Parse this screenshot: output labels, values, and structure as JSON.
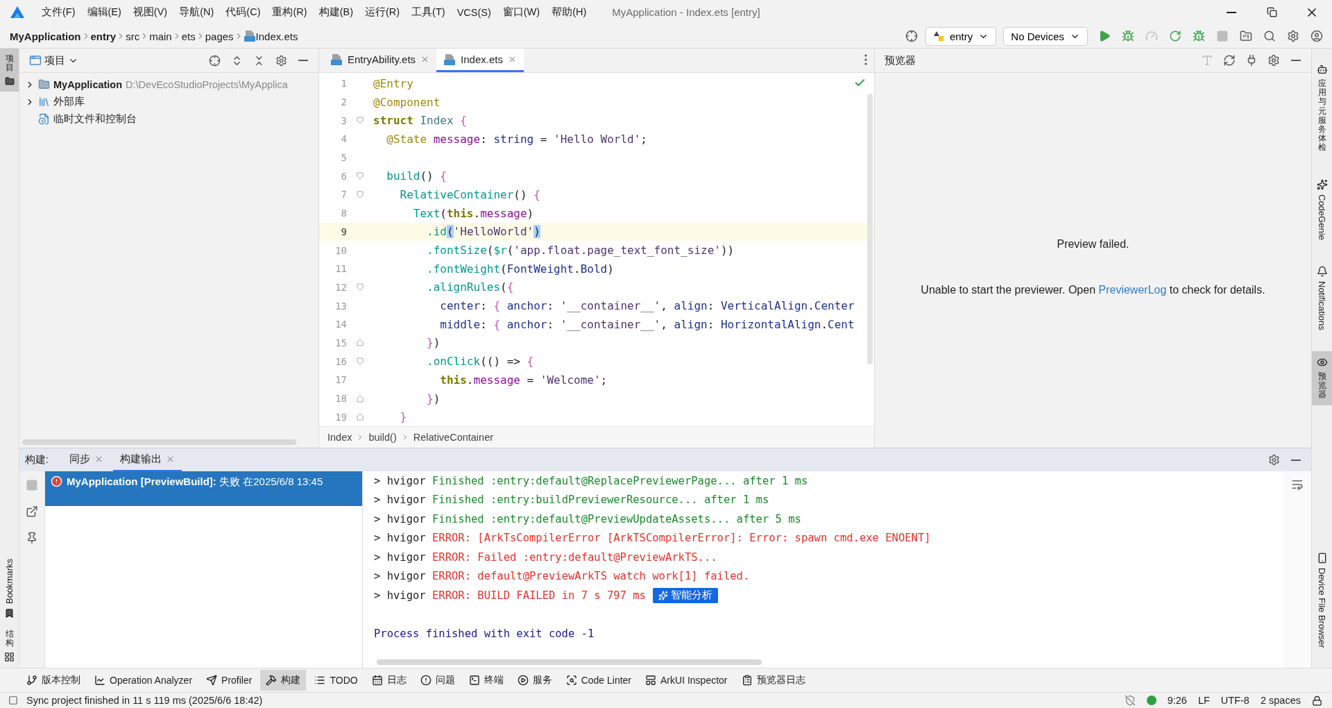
{
  "title_bar": {
    "menus": [
      "文件(F)",
      "编辑(E)",
      "视图(V)",
      "导航(N)",
      "代码(C)",
      "重构(R)",
      "构建(B)",
      "运行(R)",
      "工具(T)",
      "VCS(S)",
      "窗口(W)",
      "帮助(H)"
    ],
    "title": "MyApplication - Index.ets [entry]"
  },
  "nav_bar": {
    "path": [
      {
        "label": "MyApplication",
        "bold": true
      },
      {
        "label": "entry",
        "bold": true
      },
      {
        "label": "src",
        "bold": false
      },
      {
        "label": "main",
        "bold": false
      },
      {
        "label": "ets",
        "bold": false
      },
      {
        "label": "pages",
        "bold": false
      },
      {
        "label": "Index.ets",
        "bold": false,
        "kind": "file"
      }
    ],
    "module": "entry",
    "device": "No Devices",
    "actions": [
      {
        "kind": "run",
        "disabled": false
      },
      {
        "kind": "debug",
        "disabled": false
      },
      {
        "kind": "profile",
        "disabled": true
      },
      {
        "kind": "reload",
        "disabled": false
      },
      {
        "kind": "attach",
        "disabled": false
      },
      {
        "kind": "stop",
        "disabled": true
      },
      {
        "kind": "structure",
        "disabled": false
      },
      {
        "kind": "search",
        "disabled": false
      },
      {
        "kind": "settings",
        "disabled": false
      },
      {
        "kind": "account",
        "disabled": false
      }
    ]
  },
  "left_stripe": {
    "top": [
      {
        "label": "项目",
        "selected": true
      }
    ],
    "bottom": [
      {
        "label": "Bookmarks",
        "kind": "bookmark",
        "selected": false
      },
      {
        "label": "结构",
        "kind": "structure",
        "selected": false
      }
    ]
  },
  "right_stripe": [
    {
      "label": "应用与元服务体检",
      "kind": "robot",
      "selected": false
    },
    {
      "label": "CodeGenie",
      "kind": "genie",
      "selected": false
    },
    {
      "label": "Notifications",
      "kind": "bell",
      "selected": false
    },
    {
      "label": "预览器",
      "kind": "eye",
      "selected": true
    },
    {
      "label": "Device File Browser",
      "kind": "device",
      "selected": false
    }
  ],
  "project": {
    "title": "项目",
    "tree": [
      {
        "label": "MyApplication",
        "detail": "D:\\DevEcoStudioProjects\\MyApplica",
        "kind": "module",
        "expanded": false
      },
      {
        "label": "外部库",
        "kind": "library",
        "expanded": false
      },
      {
        "label": "临时文件和控制台",
        "kind": "scratch"
      }
    ]
  },
  "editor": {
    "tabs": [
      {
        "label": "EntryAbility.ets",
        "selected": false
      },
      {
        "label": "Index.ets",
        "selected": true
      }
    ],
    "lines": [
      {
        "number": "1",
        "current": false,
        "kind": "plain",
        "tokens": [
          {
            "kind": "annotation",
            "text": "@Entry"
          }
        ]
      },
      {
        "number": "2",
        "current": false,
        "kind": "plain",
        "tokens": [
          {
            "kind": "annotation",
            "text": "@Component"
          }
        ]
      },
      {
        "number": "3",
        "current": false,
        "kind": "fold_start",
        "tokens": [
          {
            "kind": "keyword",
            "text": "struct"
          },
          {
            "kind": "class",
            "text": " Index"
          },
          {
            "kind": "brace",
            "text": " {"
          }
        ]
      },
      {
        "number": "4",
        "current": false,
        "kind": "plain",
        "tokens": [
          {
            "kind": "annotation",
            "text": "  @State"
          },
          {
            "kind": "field",
            "text": " message"
          },
          {
            "kind": "plain",
            "text": ": "
          },
          {
            "kind": "type",
            "text": "string"
          },
          {
            "kind": "plain",
            "text": " = "
          },
          {
            "kind": "string",
            "text": "'Hello World'"
          },
          {
            "kind": "plain",
            "text": ";"
          }
        ]
      },
      {
        "number": "5",
        "current": false,
        "kind": "plain"
      },
      {
        "number": "6",
        "current": false,
        "kind": "fold_start",
        "tokens": [
          {
            "kind": "call",
            "text": "  build"
          },
          {
            "kind": "plain",
            "text": "() "
          },
          {
            "kind": "brace",
            "text": "{"
          }
        ]
      },
      {
        "number": "7",
        "current": false,
        "kind": "fold_start",
        "tokens": [
          {
            "kind": "call",
            "text": "    RelativeContainer"
          },
          {
            "kind": "plain",
            "text": "() "
          },
          {
            "kind": "brace",
            "text": "{"
          }
        ]
      },
      {
        "number": "8",
        "current": false,
        "kind": "plain",
        "tokens": [
          {
            "kind": "call",
            "text": "      Text"
          },
          {
            "kind": "plain",
            "text": "("
          },
          {
            "kind": "keyword",
            "text": "this"
          },
          {
            "kind": "plain",
            "text": "."
          },
          {
            "kind": "field",
            "text": "message"
          },
          {
            "kind": "plain",
            "text": ")"
          }
        ]
      },
      {
        "number": "9",
        "current": true,
        "kind": "plain",
        "tokens": [
          {
            "kind": "call",
            "text": "        .id"
          },
          {
            "kind": "match",
            "text": "("
          },
          {
            "kind": "string",
            "text": "'HelloWorld'"
          },
          {
            "kind": "match",
            "text": ")"
          }
        ]
      },
      {
        "number": "10",
        "current": false,
        "kind": "plain",
        "tokens": [
          {
            "kind": "call",
            "text": "        .fontSize"
          },
          {
            "kind": "plain",
            "text": "("
          },
          {
            "kind": "call",
            "text": "$r"
          },
          {
            "kind": "plain",
            "text": "("
          },
          {
            "kind": "string",
            "text": "'app.float.page_text_font_size'"
          },
          {
            "kind": "plain",
            "text": "))"
          }
        ]
      },
      {
        "number": "11",
        "current": false,
        "kind": "plain",
        "tokens": [
          {
            "kind": "call",
            "text": "        .fontWeight"
          },
          {
            "kind": "plain",
            "text": "("
          },
          {
            "kind": "type",
            "text": "FontWeight"
          },
          {
            "kind": "plain",
            "text": "."
          },
          {
            "kind": "prop",
            "text": "Bold"
          },
          {
            "kind": "plain",
            "text": ")"
          }
        ]
      },
      {
        "number": "12",
        "current": false,
        "kind": "fold_start",
        "tokens": [
          {
            "kind": "call",
            "text": "        .alignRules"
          },
          {
            "kind": "plain",
            "text": "("
          },
          {
            "kind": "brace",
            "text": "{"
          }
        ]
      },
      {
        "number": "13",
        "current": false,
        "kind": "plain",
        "tokens": [
          {
            "kind": "prop",
            "text": "          center"
          },
          {
            "kind": "plain",
            "text": ": "
          },
          {
            "kind": "brace",
            "text": "{"
          },
          {
            "kind": "prop",
            "text": " anchor"
          },
          {
            "kind": "plain",
            "text": ": "
          },
          {
            "kind": "string",
            "text": "'__container__'"
          },
          {
            "kind": "plain",
            "text": ", "
          },
          {
            "kind": "prop",
            "text": "align"
          },
          {
            "kind": "plain",
            "text": ": "
          },
          {
            "kind": "type",
            "text": "VerticalAlign"
          },
          {
            "kind": "plain",
            "text": "."
          },
          {
            "kind": "prop",
            "text": "Center"
          }
        ]
      },
      {
        "number": "14",
        "current": false,
        "kind": "plain",
        "tokens": [
          {
            "kind": "prop",
            "text": "          middle"
          },
          {
            "kind": "plain",
            "text": ": "
          },
          {
            "kind": "brace",
            "text": "{"
          },
          {
            "kind": "prop",
            "text": " anchor"
          },
          {
            "kind": "plain",
            "text": ": "
          },
          {
            "kind": "string",
            "text": "'__container__'"
          },
          {
            "kind": "plain",
            "text": ", "
          },
          {
            "kind": "prop",
            "text": "align"
          },
          {
            "kind": "plain",
            "text": ": "
          },
          {
            "kind": "type",
            "text": "HorizontalAlign"
          },
          {
            "kind": "plain",
            "text": "."
          },
          {
            "kind": "prop",
            "text": "Cent"
          }
        ]
      },
      {
        "number": "15",
        "current": false,
        "kind": "fold_end",
        "tokens": [
          {
            "kind": "brace",
            "text": "        }"
          },
          {
            "kind": "plain",
            "text": ")"
          }
        ]
      },
      {
        "number": "16",
        "current": false,
        "kind": "fold_start",
        "tokens": [
          {
            "kind": "call",
            "text": "        .onClick"
          },
          {
            "kind": "plain",
            "text": "(() => "
          },
          {
            "kind": "brace",
            "text": "{"
          }
        ]
      },
      {
        "number": "17",
        "current": false,
        "kind": "plain",
        "tokens": [
          {
            "kind": "keyword",
            "text": "          this"
          },
          {
            "kind": "plain",
            "text": "."
          },
          {
            "kind": "field",
            "text": "message"
          },
          {
            "kind": "plain",
            "text": " = "
          },
          {
            "kind": "string",
            "text": "'Welcome'"
          },
          {
            "kind": "plain",
            "text": ";"
          }
        ]
      },
      {
        "number": "18",
        "current": false,
        "kind": "fold_end",
        "tokens": [
          {
            "kind": "brace",
            "text": "        }"
          },
          {
            "kind": "plain",
            "text": ")"
          }
        ]
      },
      {
        "number": "19",
        "current": false,
        "kind": "fold_end",
        "tokens": [
          {
            "kind": "brace",
            "text": "    }"
          }
        ]
      }
    ],
    "breadcrumb": [
      "Index",
      "build()",
      "RelativeContainer"
    ]
  },
  "preview": {
    "title": "预览器",
    "actions": [
      {
        "kind": "font",
        "disabled": true
      },
      {
        "kind": "refresh",
        "disabled": false
      },
      {
        "kind": "plug",
        "disabled": false
      },
      {
        "kind": "settings",
        "disabled": false
      },
      {
        "kind": "minimize",
        "disabled": false
      }
    ],
    "heading": "Preview failed.",
    "message_before": "Unable to start the previewer. Open ",
    "link": "PreviewerLog",
    "message_after": " to check for details."
  },
  "build_panel": {
    "label": "构建:",
    "tabs": [
      {
        "label": "同步",
        "selected": false
      },
      {
        "label": "构建输出",
        "selected": true
      }
    ],
    "actions": [
      {
        "kind": "stop",
        "disabled": true
      },
      {
        "kind": "external",
        "disabled": false
      },
      {
        "kind": "pin",
        "disabled": false
      }
    ],
    "tree": [
      {
        "text": "**MyApplication [PreviewBuild]:** 失败 在2025/6/8 13:45",
        "kind": "error",
        "selected": true
      }
    ],
    "console": [
      {
        "prompt": "> hvigor ",
        "text": "Finished :entry:default@ReplacePreviewerPage... after 1 ms",
        "kind": "info"
      },
      {
        "prompt": "> hvigor ",
        "text": "Finished :entry:buildPreviewerResource... after 1 ms",
        "kind": "info"
      },
      {
        "prompt": "> hvigor ",
        "text": "Finished :entry:default@PreviewUpdateAssets... after 5 ms",
        "kind": "info"
      },
      {
        "prompt": "> hvigor ",
        "text": "ERROR: [ArkTsCompilerError [ArkTSCompilerError]: Error: spawn cmd.exe ENOENT]",
        "kind": "error"
      },
      {
        "prompt": "> hvigor ",
        "text": "ERROR: Failed :entry:default@PreviewArkTS...",
        "kind": "error"
      },
      {
        "prompt": "> hvigor ",
        "text": "ERROR: default@PreviewArkTS watch work[1] failed.",
        "kind": "error"
      },
      {
        "prompt": "> hvigor ",
        "text": "ERROR: BUILD FAILED in 7 s 797 ms",
        "kind": "error",
        "badge": "智能分析"
      },
      {
        "text": "Process finished with exit code -1",
        "kind": "exit"
      }
    ]
  },
  "tool_windows": [
    {
      "label": "版本控制",
      "kind": "vcs",
      "selected": false
    },
    {
      "label": "Operation Analyzer",
      "kind": "chart",
      "selected": false
    },
    {
      "label": "Profiler",
      "kind": "profiler",
      "selected": false
    },
    {
      "label": "构建",
      "kind": "build",
      "selected": true
    },
    {
      "label": "TODO",
      "kind": "todo",
      "selected": false
    },
    {
      "label": "日志",
      "kind": "log",
      "selected": false
    },
    {
      "label": "问题",
      "kind": "problems",
      "selected": false
    },
    {
      "label": "终端",
      "kind": "terminal",
      "selected": false
    },
    {
      "label": "服务",
      "kind": "services",
      "selected": false
    },
    {
      "label": "Code Linter",
      "kind": "linter",
      "selected": false
    },
    {
      "label": "ArkUI Inspector",
      "kind": "inspector",
      "selected": false
    },
    {
      "label": "预览器日志",
      "kind": "previewlog",
      "selected": false
    }
  ],
  "status_bar": {
    "message": "Sync project finished in 11 s 119 ms (2025/6/6 18:42)",
    "indicators": [
      "9:26",
      "LF",
      "UTF-8",
      "2 spaces"
    ]
  }
}
